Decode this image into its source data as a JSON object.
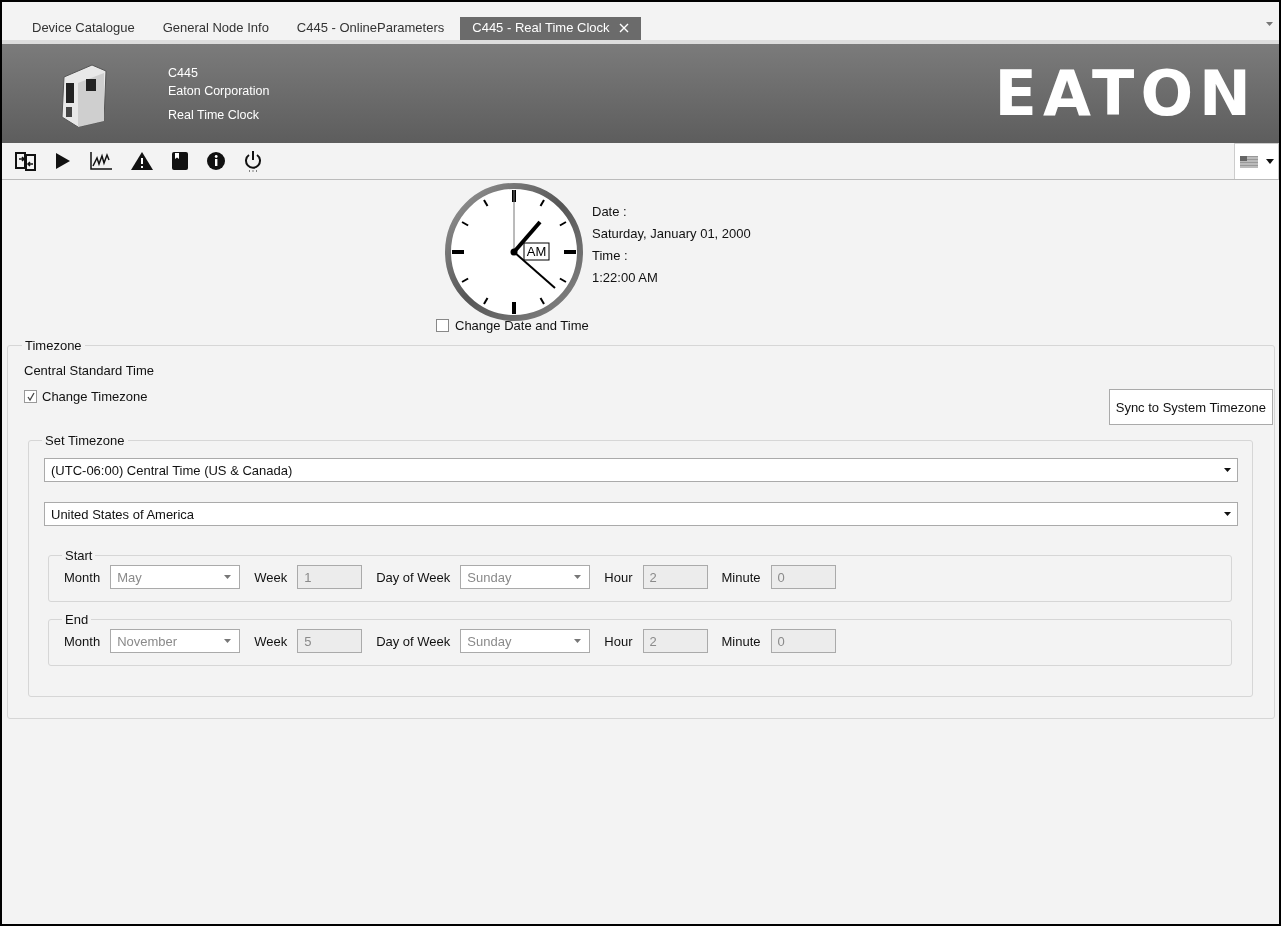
{
  "tabs": [
    {
      "label": "Device Catalogue",
      "selected": false
    },
    {
      "label": "General Node Info",
      "selected": false
    },
    {
      "label": "C445 - OnlineParameters",
      "selected": false
    },
    {
      "label": "C445 - Real Time Clock",
      "selected": true
    }
  ],
  "header": {
    "device": "C445",
    "vendor": "Eaton Corporation",
    "page": "Real Time Clock",
    "logo": "EATON"
  },
  "clock": {
    "am_pm": "AM",
    "date_label": "Date :",
    "date": "Saturday, January 01, 2000",
    "time_label": "Time :",
    "time": "1:22:00 AM"
  },
  "change_date_time": {
    "label": "Change Date and Time",
    "checked": false
  },
  "timezone": {
    "title": "Timezone",
    "current": "Central Standard Time",
    "change_timezone": {
      "label": "Change Timezone",
      "checked": true
    },
    "sync_button": "Sync to System Timezone",
    "set_timezone": {
      "title": "Set Timezone",
      "zone": "(UTC-06:00) Central Time (US & Canada)",
      "region": "United States of America",
      "periods": [
        {
          "title": "Start",
          "disabled": true,
          "fields": [
            {
              "label": "Month",
              "kind": "select",
              "value": "May"
            },
            {
              "label": "Week",
              "kind": "text",
              "value": "1"
            },
            {
              "label": "Day of Week",
              "kind": "select",
              "value": "Sunday"
            },
            {
              "label": "Hour",
              "kind": "text",
              "value": "2"
            },
            {
              "label": "Minute",
              "kind": "text",
              "value": "0"
            }
          ]
        },
        {
          "title": "End",
          "disabled": true,
          "fields": [
            {
              "label": "Month",
              "kind": "select",
              "value": "November"
            },
            {
              "label": "Week",
              "kind": "text",
              "value": "5"
            },
            {
              "label": "Day of Week",
              "kind": "select",
              "value": "Sunday"
            },
            {
              "label": "Hour",
              "kind": "text",
              "value": "2"
            },
            {
              "label": "Minute",
              "kind": "text",
              "value": "0"
            }
          ]
        }
      ]
    }
  }
}
